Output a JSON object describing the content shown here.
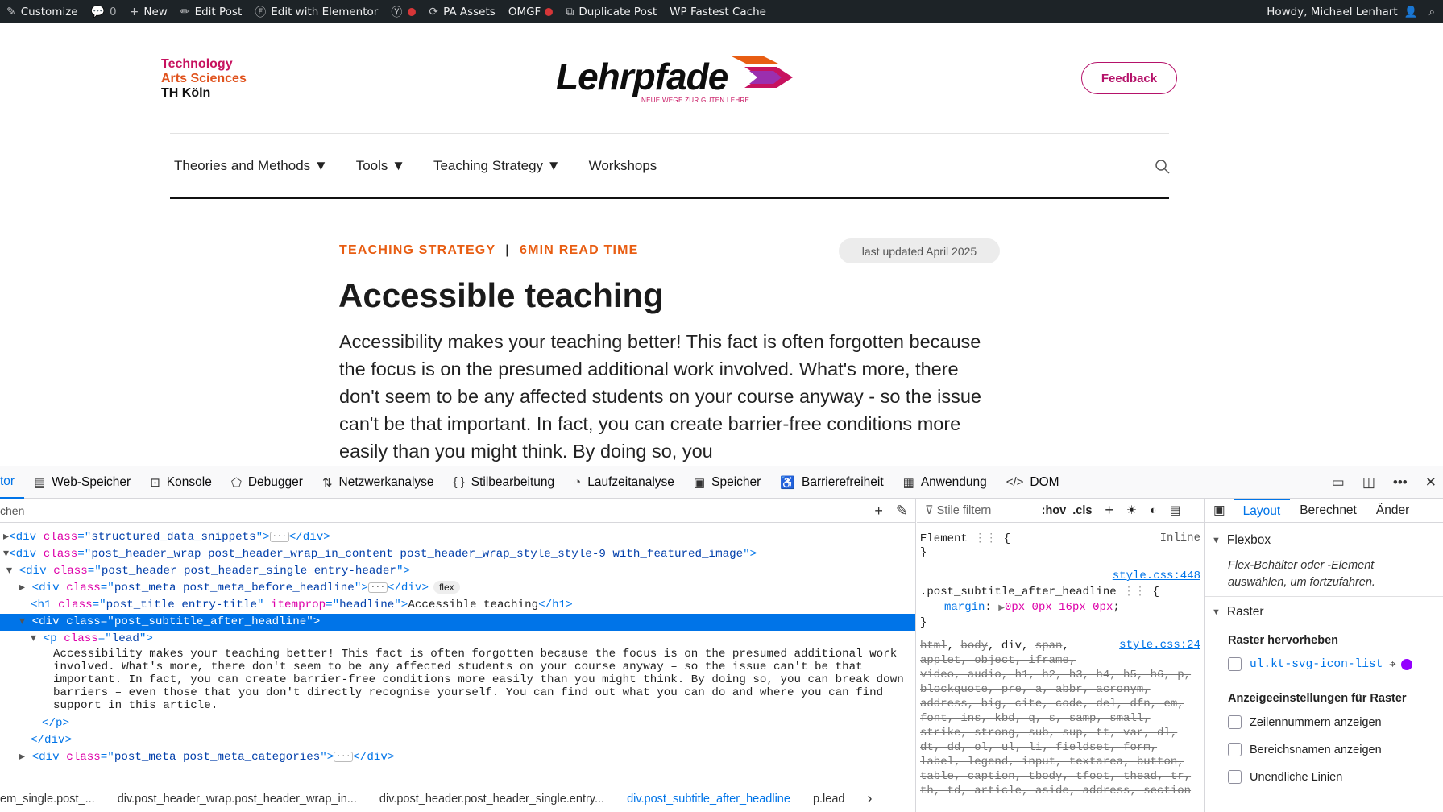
{
  "admin_bar": {
    "customize": "Customize",
    "comments_count": "0",
    "new": "New",
    "edit_post": "Edit Post",
    "edit_elementor": "Edit with Elementor",
    "pa_assets": "PA Assets",
    "omgf": "OMGF",
    "duplicate_post": "Duplicate Post",
    "fastest_cache": "WP Fastest Cache",
    "howdy": "Howdy, Michael Lenhart"
  },
  "site": {
    "logo_left": [
      "Technology",
      "Arts Sciences",
      "TH Köln"
    ],
    "brand": "Lehrpfade",
    "brand_tagline": "NEUE WEGE ZUR GUTEN LEHRE",
    "feedback": "Feedback",
    "nav": [
      "Theories and Methods ▼",
      "Tools ▼",
      "Teaching Strategy ▼",
      "Workshops"
    ],
    "meta_category": "TEACHING STRATEGY",
    "meta_sep": "|",
    "meta_readtime": "6MIN READ TIME",
    "updated": "last updated April 2025",
    "title": "Accessible teaching",
    "lead": "Accessibility makes your teaching better! This fact is often forgotten because the focus is on the presumed additional work involved. What's more, there don't seem to be any affected students on your course anyway - so the issue can't be that important. In fact, you can create barrier-free conditions more easily than you might think. By doing so, you"
  },
  "devtools": {
    "tabs": [
      "tor",
      "Web-Speicher",
      "Konsole",
      "Debugger",
      "Netzwerkanalyse",
      "Stilbearbeitung",
      "Laufzeitanalyse",
      "Speicher",
      "Barrierefreiheit",
      "Anwendung",
      "DOM"
    ],
    "search_placeholder": "chen",
    "tree": {
      "l1_class": "structured_data_snippets",
      "l2_class": "post_header_wrap post_header_wrap_in_content post_header_wrap_style_style-9 with_featured_image",
      "l3_class": "post_header post_header_single entry-header",
      "l4_class": "post_meta post_meta_before_headline",
      "l4_badge": "flex",
      "l5_class": "post_title entry-title",
      "l5_itemprop": "headline",
      "l5_text": "Accessible teaching",
      "l6_class": "post_subtitle_after_headline",
      "l7_class": "lead",
      "text_lines": [
        "Accessibility makes your teaching better! This fact is often forgotten because the focus is on the presumed additional work",
        "involved. What's more, there don't seem to be any affected students on your course anyway – so the issue can't be that",
        "important. In fact, you can create barrier-free conditions more easily than you might think. By doing so, you can break down",
        "barriers – even those that you don't directly recognise yourself. You can find out what you can do and where you can find",
        "support in this article."
      ],
      "l_last_class": "post_meta post_meta_categories"
    },
    "breadcrumbs": [
      "em_single.post_...",
      "div.post_header_wrap.post_header_wrap_in...",
      "div.post_header.post_header_single.entry...",
      "div.post_subtitle_after_headline",
      "p.lead"
    ],
    "rules": {
      "filter_placeholder": "Stile filtern",
      "hov": ":hov",
      "cls": ".cls",
      "element_label": "Element",
      "inline": "Inline",
      "source1": "style.css:448",
      "selector1": ".post_subtitle_after_headline",
      "prop1": "margin",
      "val1": "0px 0px 16px 0px",
      "source2": "style.css:24",
      "selector_lines": [
        "html, body, div, span,",
        "applet, object, iframe,",
        "video, audio, h1, h2, h3, h4, h5, h6, p,",
        "blockquote, pre, a, abbr, acronym,",
        "address, big, cite, code, del, dfn, em,",
        "font, ins, kbd, q, s, samp, small,",
        "strike, strong, sub, sup, tt, var, dl,",
        "dt, dd, ol, ul, li, fieldset, form,",
        "label, legend, input, textarea, button,",
        "table, caption, tbody, tfoot, thead, tr,",
        "th, td, article, aside, address, section"
      ]
    },
    "layout": {
      "tabs": [
        "Layout",
        "Berechnet",
        "Änder"
      ],
      "flexbox": "Flexbox",
      "flex_note": "Flex-Behälter oder -Element auswählen, um fortzufahren.",
      "raster": "Raster",
      "raster_highlight": "Raster hervorheben",
      "grid_item": "ul.kt-svg-icon-list",
      "display_settings": "Anzeigeeinstellungen für Raster",
      "opt1": "Zeilennummern anzeigen",
      "opt2": "Bereichsnamen anzeigen",
      "opt3": "Unendliche Linien"
    }
  }
}
